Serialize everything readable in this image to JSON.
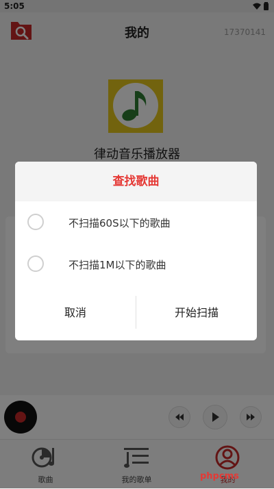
{
  "status_bar": {
    "time": "5:05"
  },
  "header": {
    "title": "我的",
    "user_id": "17370141"
  },
  "profile": {
    "app_name": "律动音乐播放器"
  },
  "bottom_nav": [
    {
      "label": "歌曲"
    },
    {
      "label": "我的歌单"
    },
    {
      "label": "我的"
    }
  ],
  "dialog": {
    "title": "查找歌曲",
    "options": [
      {
        "label": "不扫描60S以下的歌曲"
      },
      {
        "label": "不扫描1M以下的歌曲"
      }
    ],
    "cancel_label": "取消",
    "confirm_label": "开始扫描"
  },
  "watermark": {
    "text": "phpcms"
  },
  "colors": {
    "accent": "#e53935",
    "dialog_header_bg": "#f4f4f4",
    "logo_bg": "#e5c71c",
    "logo_note": "#2e7d32"
  }
}
